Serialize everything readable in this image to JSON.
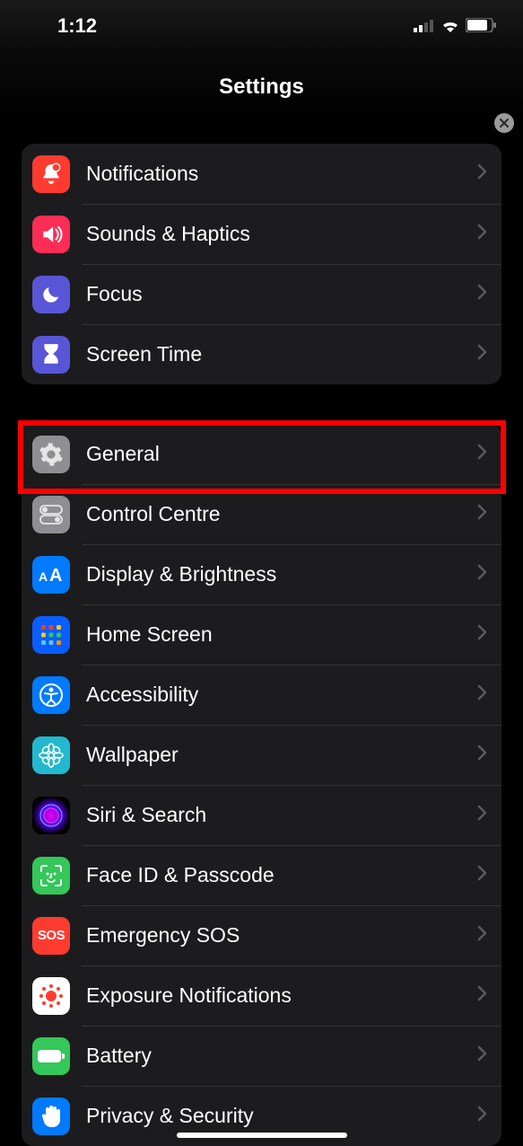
{
  "status": {
    "time": "1:12"
  },
  "header": {
    "title": "Settings"
  },
  "groups": [
    {
      "items": [
        {
          "label": "Notifications",
          "icon": "bell-badge-icon",
          "bg": "bg-red"
        },
        {
          "label": "Sounds & Haptics",
          "icon": "speaker-icon",
          "bg": "bg-pink"
        },
        {
          "label": "Focus",
          "icon": "moon-icon",
          "bg": "bg-indigo"
        },
        {
          "label": "Screen Time",
          "icon": "hourglass-icon",
          "bg": "bg-indigo"
        }
      ]
    },
    {
      "items": [
        {
          "label": "General",
          "icon": "gear-icon",
          "bg": "bg-gray",
          "highlighted": true
        },
        {
          "label": "Control Centre",
          "icon": "toggles-icon",
          "bg": "bg-gray"
        },
        {
          "label": "Display & Brightness",
          "icon": "textsize-icon",
          "bg": "bg-blue"
        },
        {
          "label": "Home Screen",
          "icon": "app-grid-icon",
          "bg": "bg-home-grid"
        },
        {
          "label": "Accessibility",
          "icon": "accessibility-icon",
          "bg": "bg-blue"
        },
        {
          "label": "Wallpaper",
          "icon": "flower-icon",
          "bg": "bg-cyan"
        },
        {
          "label": "Siri & Search",
          "icon": "siri-icon",
          "bg": "bg-gradient-siri"
        },
        {
          "label": "Face ID & Passcode",
          "icon": "faceid-icon",
          "bg": "bg-green"
        },
        {
          "label": "Emergency SOS",
          "icon": "sos-icon",
          "bg": "bg-red"
        },
        {
          "label": "Exposure Notifications",
          "icon": "exposure-icon",
          "bg": "bg-white"
        },
        {
          "label": "Battery",
          "icon": "battery-icon",
          "bg": "bg-green"
        },
        {
          "label": "Privacy & Security",
          "icon": "hand-icon",
          "bg": "bg-blue"
        }
      ]
    }
  ]
}
